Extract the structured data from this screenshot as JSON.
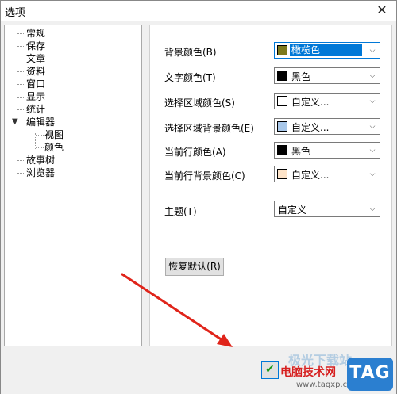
{
  "window": {
    "title": "选项",
    "close_glyph": "✕"
  },
  "tree": {
    "items": [
      {
        "label": "常规"
      },
      {
        "label": "保存"
      },
      {
        "label": "文章"
      },
      {
        "label": "资料"
      },
      {
        "label": "窗口"
      },
      {
        "label": "显示"
      },
      {
        "label": "统计"
      },
      {
        "label": "编辑器",
        "expanded": true,
        "toggle": "▼",
        "children": [
          {
            "label": "视图"
          },
          {
            "label": "颜色"
          }
        ]
      },
      {
        "label": "故事树"
      },
      {
        "label": "浏览器"
      }
    ]
  },
  "settings": {
    "rows": [
      {
        "label": "背景颜色(B)",
        "swatch": "#7d7a1e",
        "value": "橄榄色",
        "highlighted": true
      },
      {
        "label": "文字颜色(T)",
        "swatch": "#000000",
        "value": "黑色"
      },
      {
        "label": "选择区域颜色(S)",
        "swatch": "#ffffff",
        "value": "自定义..."
      },
      {
        "label": "选择区域背景颜色(E)",
        "swatch": "#a9c8ea",
        "value": "自定义..."
      },
      {
        "label": "当前行颜色(A)",
        "swatch": "#000000",
        "value": "黑色"
      },
      {
        "label": "当前行背景颜色(C)",
        "swatch": "#fde3c8",
        "value": "自定义..."
      }
    ],
    "theme": {
      "label": "主题(T)",
      "value": "自定义"
    },
    "reset_label": "恢复默认(R)",
    "dropdown_glyph": "⌵"
  },
  "bottom": {
    "ok_glyph": "✔",
    "watermark_text": "电脑技术网",
    "watermark_ghost": "极光下载站",
    "watermark_url": "www.tagxp.com",
    "logo_text": "TAG"
  },
  "colors": {
    "accent": "#0078d7",
    "arrow": "#e0241a",
    "logo": "#2b7fd0"
  }
}
